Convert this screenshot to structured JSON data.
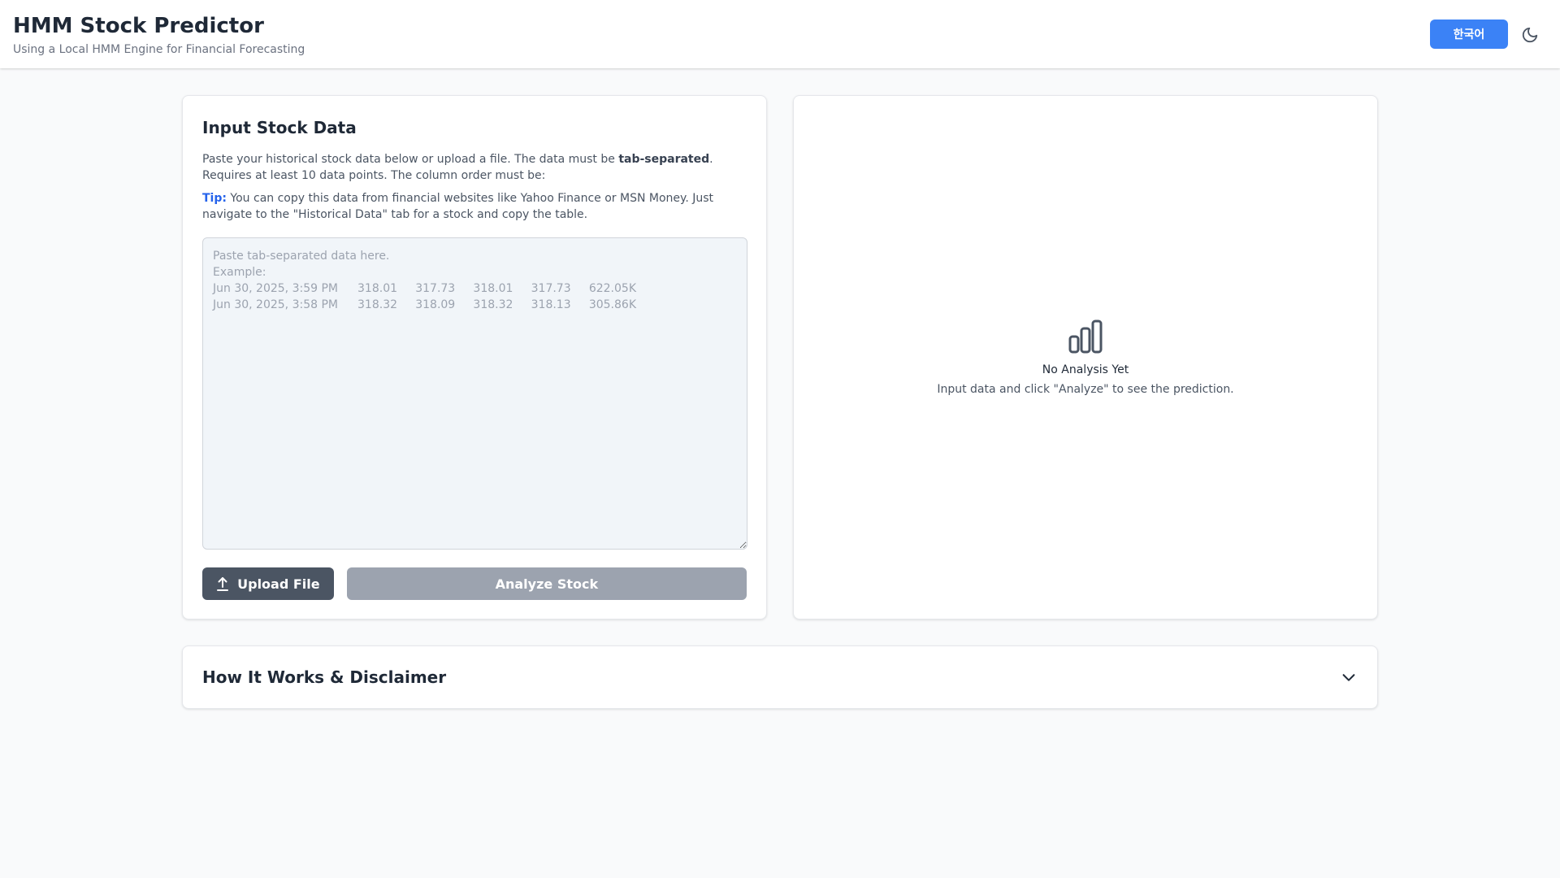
{
  "header": {
    "title": "HMM Stock Predictor",
    "subtitle": "Using a Local HMM Engine for Financial Forecasting",
    "language_button": "한국어",
    "theme_icon": "moon-icon"
  },
  "input_card": {
    "title": "Input Stock Data",
    "description_before": "Paste your historical stock data below or upload a file. The data must be ",
    "description_bold": "tab-separated",
    "description_after": ". Requires at least 10 data points. The column order must be:",
    "tip_label": "Tip:",
    "tip_text": " You can copy this data from financial websites like Yahoo Finance or MSN Money. Just navigate to the \"Historical Data\" tab for a stock and copy the table.",
    "textarea_value": "",
    "textarea_placeholder": "Paste tab-separated data here.\nExample:\nJun 30, 2025, 3:59 PM\t318.01\t317.73\t318.01\t317.73\t622.05K\nJun 30, 2025, 3:58 PM\t318.32\t318.09\t318.32\t318.13\t305.86K",
    "upload_button": "Upload File",
    "upload_icon": "upload-icon",
    "analyze_button": "Analyze Stock"
  },
  "result_card": {
    "empty_icon": "bar-chart-icon",
    "empty_title": "No Analysis Yet",
    "empty_description": "Input data and click \"Analyze\" to see the prediction."
  },
  "howto_card": {
    "title": "How It Works & Disclaimer",
    "toggle_icon": "chevron-down-icon"
  },
  "colors": {
    "accent": "#3b82f6",
    "tip": "#2563eb",
    "upload_button": "#4b5563",
    "analyze_button_disabled": "#9ca3af",
    "background": "#f9fafb"
  }
}
